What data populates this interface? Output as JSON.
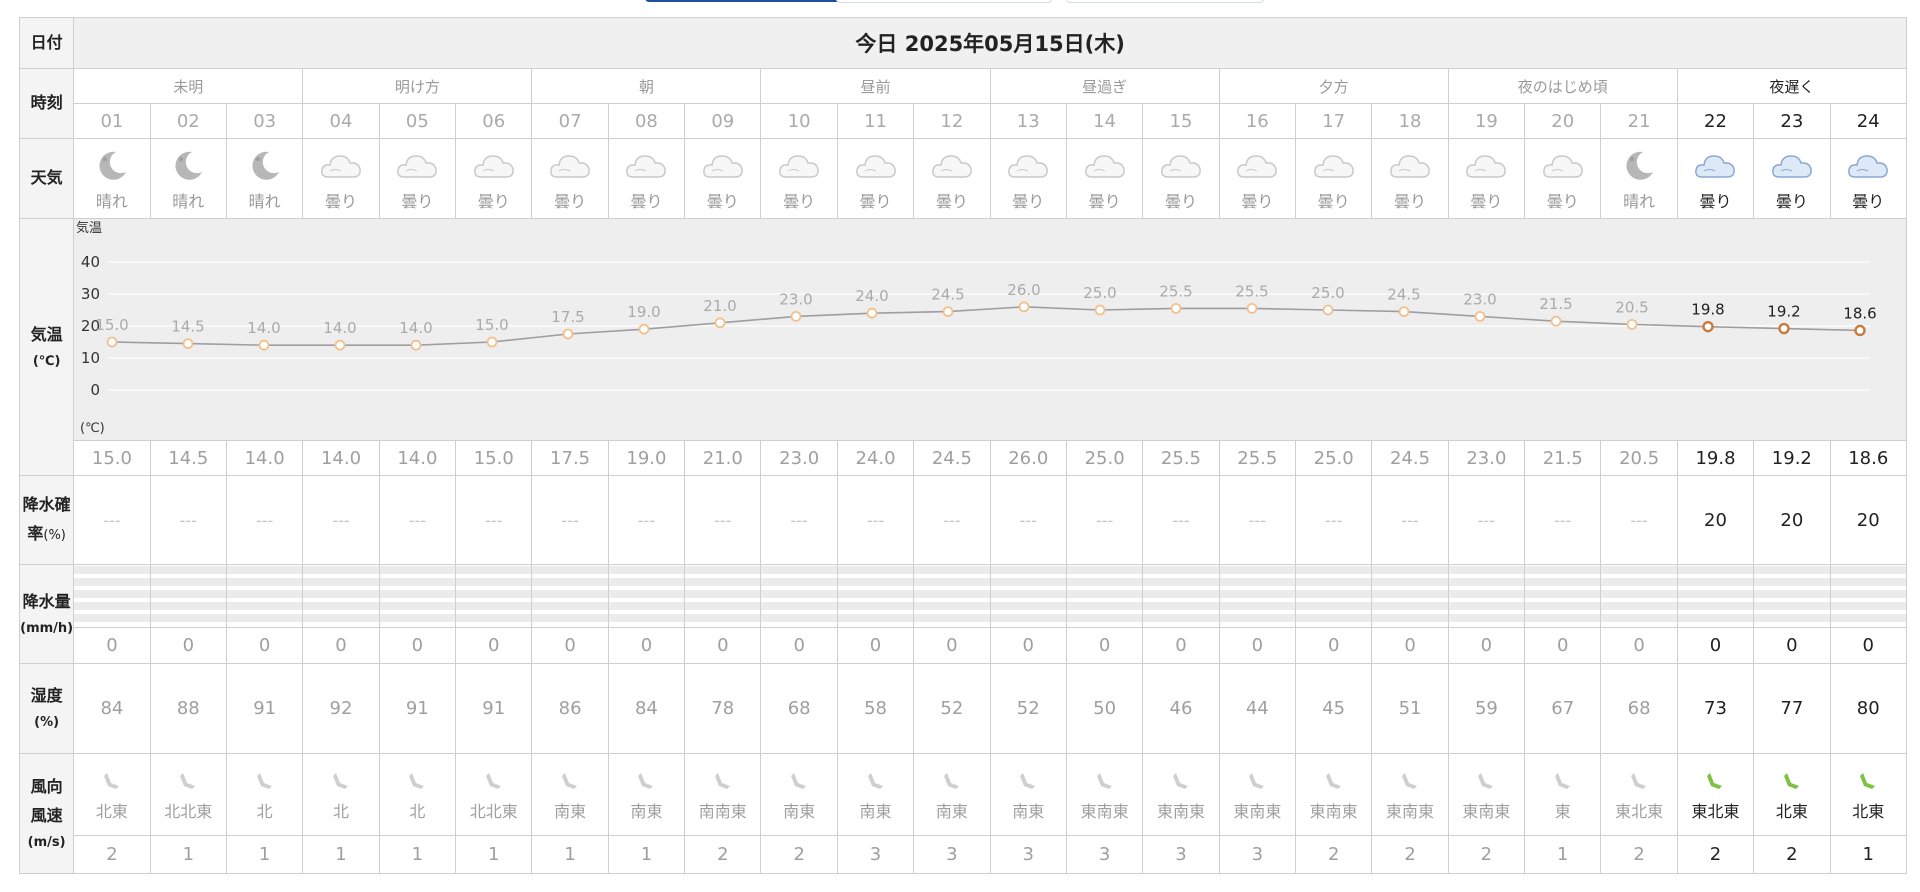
{
  "header": {
    "date_label": "日付",
    "date_value": "今日 2025年05月15日(木)"
  },
  "row_labels": {
    "time": "時刻",
    "weather": "天気",
    "temp_a": "気温",
    "temp_b": "(℃)",
    "precip_prob_a": "降水確",
    "precip_prob_b": "率",
    "precip_prob_c": "(%)",
    "precip_amt_a": "降水量",
    "precip_amt_b": "(mm/h)",
    "humidity_a": "湿度",
    "humidity_b": "(%)",
    "wind_a": "風向",
    "wind_b": "風速",
    "wind_c": "(m/s)"
  },
  "periods": [
    {
      "label": "未明",
      "span": 3,
      "current": false
    },
    {
      "label": "明け方",
      "span": 3,
      "current": false
    },
    {
      "label": "朝",
      "span": 3,
      "current": false
    },
    {
      "label": "昼前",
      "span": 3,
      "current": false
    },
    {
      "label": "昼過ぎ",
      "span": 3,
      "current": false
    },
    {
      "label": "夕方",
      "span": 3,
      "current": false
    },
    {
      "label": "夜のはじめ頃",
      "span": 3,
      "current": false
    },
    {
      "label": "夜遅く",
      "span": 3,
      "current": true
    }
  ],
  "hours": [
    {
      "hour": "01",
      "weather": "晴れ",
      "icon": "moon-clear-icon",
      "temp": "15.0",
      "pop": "---",
      "rain": "0",
      "humidity": "84",
      "wind_dir": "北東",
      "wind_speed": "2",
      "current": false
    },
    {
      "hour": "02",
      "weather": "晴れ",
      "icon": "moon-clear-icon",
      "temp": "14.5",
      "pop": "---",
      "rain": "0",
      "humidity": "88",
      "wind_dir": "北北東",
      "wind_speed": "1",
      "current": false
    },
    {
      "hour": "03",
      "weather": "晴れ",
      "icon": "moon-clear-icon",
      "temp": "14.0",
      "pop": "---",
      "rain": "0",
      "humidity": "91",
      "wind_dir": "北",
      "wind_speed": "1",
      "current": false
    },
    {
      "hour": "04",
      "weather": "曇り",
      "icon": "cloud-icon",
      "temp": "14.0",
      "pop": "---",
      "rain": "0",
      "humidity": "92",
      "wind_dir": "北",
      "wind_speed": "1",
      "current": false
    },
    {
      "hour": "05",
      "weather": "曇り",
      "icon": "cloud-icon",
      "temp": "14.0",
      "pop": "---",
      "rain": "0",
      "humidity": "91",
      "wind_dir": "北",
      "wind_speed": "1",
      "current": false
    },
    {
      "hour": "06",
      "weather": "曇り",
      "icon": "cloud-icon",
      "temp": "15.0",
      "pop": "---",
      "rain": "0",
      "humidity": "91",
      "wind_dir": "北北東",
      "wind_speed": "1",
      "current": false
    },
    {
      "hour": "07",
      "weather": "曇り",
      "icon": "cloud-icon",
      "temp": "17.5",
      "pop": "---",
      "rain": "0",
      "humidity": "86",
      "wind_dir": "南東",
      "wind_speed": "1",
      "current": false
    },
    {
      "hour": "08",
      "weather": "曇り",
      "icon": "cloud-icon",
      "temp": "19.0",
      "pop": "---",
      "rain": "0",
      "humidity": "84",
      "wind_dir": "南東",
      "wind_speed": "1",
      "current": false
    },
    {
      "hour": "09",
      "weather": "曇り",
      "icon": "cloud-icon",
      "temp": "21.0",
      "pop": "---",
      "rain": "0",
      "humidity": "78",
      "wind_dir": "南南東",
      "wind_speed": "2",
      "current": false
    },
    {
      "hour": "10",
      "weather": "曇り",
      "icon": "cloud-icon",
      "temp": "23.0",
      "pop": "---",
      "rain": "0",
      "humidity": "68",
      "wind_dir": "南東",
      "wind_speed": "2",
      "current": false
    },
    {
      "hour": "11",
      "weather": "曇り",
      "icon": "cloud-icon",
      "temp": "24.0",
      "pop": "---",
      "rain": "0",
      "humidity": "58",
      "wind_dir": "南東",
      "wind_speed": "3",
      "current": false
    },
    {
      "hour": "12",
      "weather": "曇り",
      "icon": "cloud-icon",
      "temp": "24.5",
      "pop": "---",
      "rain": "0",
      "humidity": "52",
      "wind_dir": "南東",
      "wind_speed": "3",
      "current": false
    },
    {
      "hour": "13",
      "weather": "曇り",
      "icon": "cloud-icon",
      "temp": "26.0",
      "pop": "---",
      "rain": "0",
      "humidity": "52",
      "wind_dir": "南東",
      "wind_speed": "3",
      "current": false
    },
    {
      "hour": "14",
      "weather": "曇り",
      "icon": "cloud-icon",
      "temp": "25.0",
      "pop": "---",
      "rain": "0",
      "humidity": "50",
      "wind_dir": "東南東",
      "wind_speed": "3",
      "current": false
    },
    {
      "hour": "15",
      "weather": "曇り",
      "icon": "cloud-icon",
      "temp": "25.5",
      "pop": "---",
      "rain": "0",
      "humidity": "46",
      "wind_dir": "東南東",
      "wind_speed": "3",
      "current": false
    },
    {
      "hour": "16",
      "weather": "曇り",
      "icon": "cloud-icon",
      "temp": "25.5",
      "pop": "---",
      "rain": "0",
      "humidity": "44",
      "wind_dir": "東南東",
      "wind_speed": "3",
      "current": false
    },
    {
      "hour": "17",
      "weather": "曇り",
      "icon": "cloud-icon",
      "temp": "25.0",
      "pop": "---",
      "rain": "0",
      "humidity": "45",
      "wind_dir": "東南東",
      "wind_speed": "2",
      "current": false
    },
    {
      "hour": "18",
      "weather": "曇り",
      "icon": "cloud-icon",
      "temp": "24.5",
      "pop": "---",
      "rain": "0",
      "humidity": "51",
      "wind_dir": "東南東",
      "wind_speed": "2",
      "current": false
    },
    {
      "hour": "19",
      "weather": "曇り",
      "icon": "cloud-icon",
      "temp": "23.0",
      "pop": "---",
      "rain": "0",
      "humidity": "59",
      "wind_dir": "東南東",
      "wind_speed": "2",
      "current": false
    },
    {
      "hour": "20",
      "weather": "曇り",
      "icon": "cloud-icon",
      "temp": "21.5",
      "pop": "---",
      "rain": "0",
      "humidity": "67",
      "wind_dir": "東",
      "wind_speed": "1",
      "current": false
    },
    {
      "hour": "21",
      "weather": "晴れ",
      "icon": "moon-clear-icon",
      "temp": "20.5",
      "pop": "---",
      "rain": "0",
      "humidity": "68",
      "wind_dir": "東北東",
      "wind_speed": "2",
      "current": false
    },
    {
      "hour": "22",
      "weather": "曇り",
      "icon": "cloud-icon",
      "temp": "19.8",
      "pop": "20",
      "rain": "0",
      "humidity": "73",
      "wind_dir": "東北東",
      "wind_speed": "2",
      "current": true
    },
    {
      "hour": "23",
      "weather": "曇り",
      "icon": "cloud-icon",
      "temp": "19.2",
      "pop": "20",
      "rain": "0",
      "humidity": "77",
      "wind_dir": "北東",
      "wind_speed": "2",
      "current": true
    },
    {
      "hour": "24",
      "weather": "曇り",
      "icon": "cloud-icon",
      "temp": "18.6",
      "pop": "20",
      "rain": "0",
      "humidity": "80",
      "wind_dir": "北東",
      "wind_speed": "1",
      "current": true
    }
  ],
  "chart_data": {
    "type": "line",
    "ylabel": "気温",
    "yunit": "(℃)",
    "ylim": [
      -5,
      45
    ],
    "yticks": [
      "40",
      "30",
      "20",
      "10",
      "0"
    ],
    "grid": true,
    "categories": [
      "01",
      "02",
      "03",
      "04",
      "05",
      "06",
      "07",
      "08",
      "09",
      "10",
      "11",
      "12",
      "13",
      "14",
      "15",
      "16",
      "17",
      "18",
      "19",
      "20",
      "21",
      "22",
      "23",
      "24"
    ],
    "values": [
      15.0,
      14.5,
      14.0,
      14.0,
      14.0,
      15.0,
      17.5,
      19.0,
      21.0,
      23.0,
      24.0,
      24.5,
      26.0,
      25.0,
      25.5,
      25.5,
      25.0,
      24.5,
      23.0,
      21.5,
      20.5,
      19.8,
      19.2,
      18.6
    ],
    "labels": [
      "15.0",
      "14.5",
      "14.0",
      "14.0",
      "14.0",
      "15.0",
      "17.5",
      "19.0",
      "21.0",
      "23.0",
      "24.0",
      "24.5",
      "26.0",
      "25.0",
      "25.5",
      "25.5",
      "25.0",
      "24.5",
      "23.0",
      "21.5",
      "20.5",
      "19.8",
      "19.2",
      "18.6"
    ],
    "current_from_index": 21
  },
  "colors": {
    "marker_light": "#f2c08e",
    "marker_dark": "#c97a3a",
    "line": "#9e9e9e",
    "wind_arrow": "#cfcfcf",
    "wind_arrow_current": "#7fc142"
  }
}
